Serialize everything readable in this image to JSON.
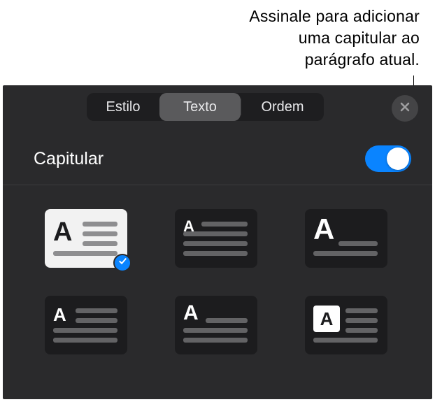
{
  "callout": {
    "text": "Assinale para adicionar\numa capitular ao\nparágrafo atual."
  },
  "tabs": {
    "estilo": "Estilo",
    "texto": "Texto",
    "ordem": "Ordem",
    "active": "texto"
  },
  "section": {
    "title": "Capitular",
    "toggle_on": true
  },
  "dropcap": {
    "letter": "A",
    "selected_index": 0
  }
}
